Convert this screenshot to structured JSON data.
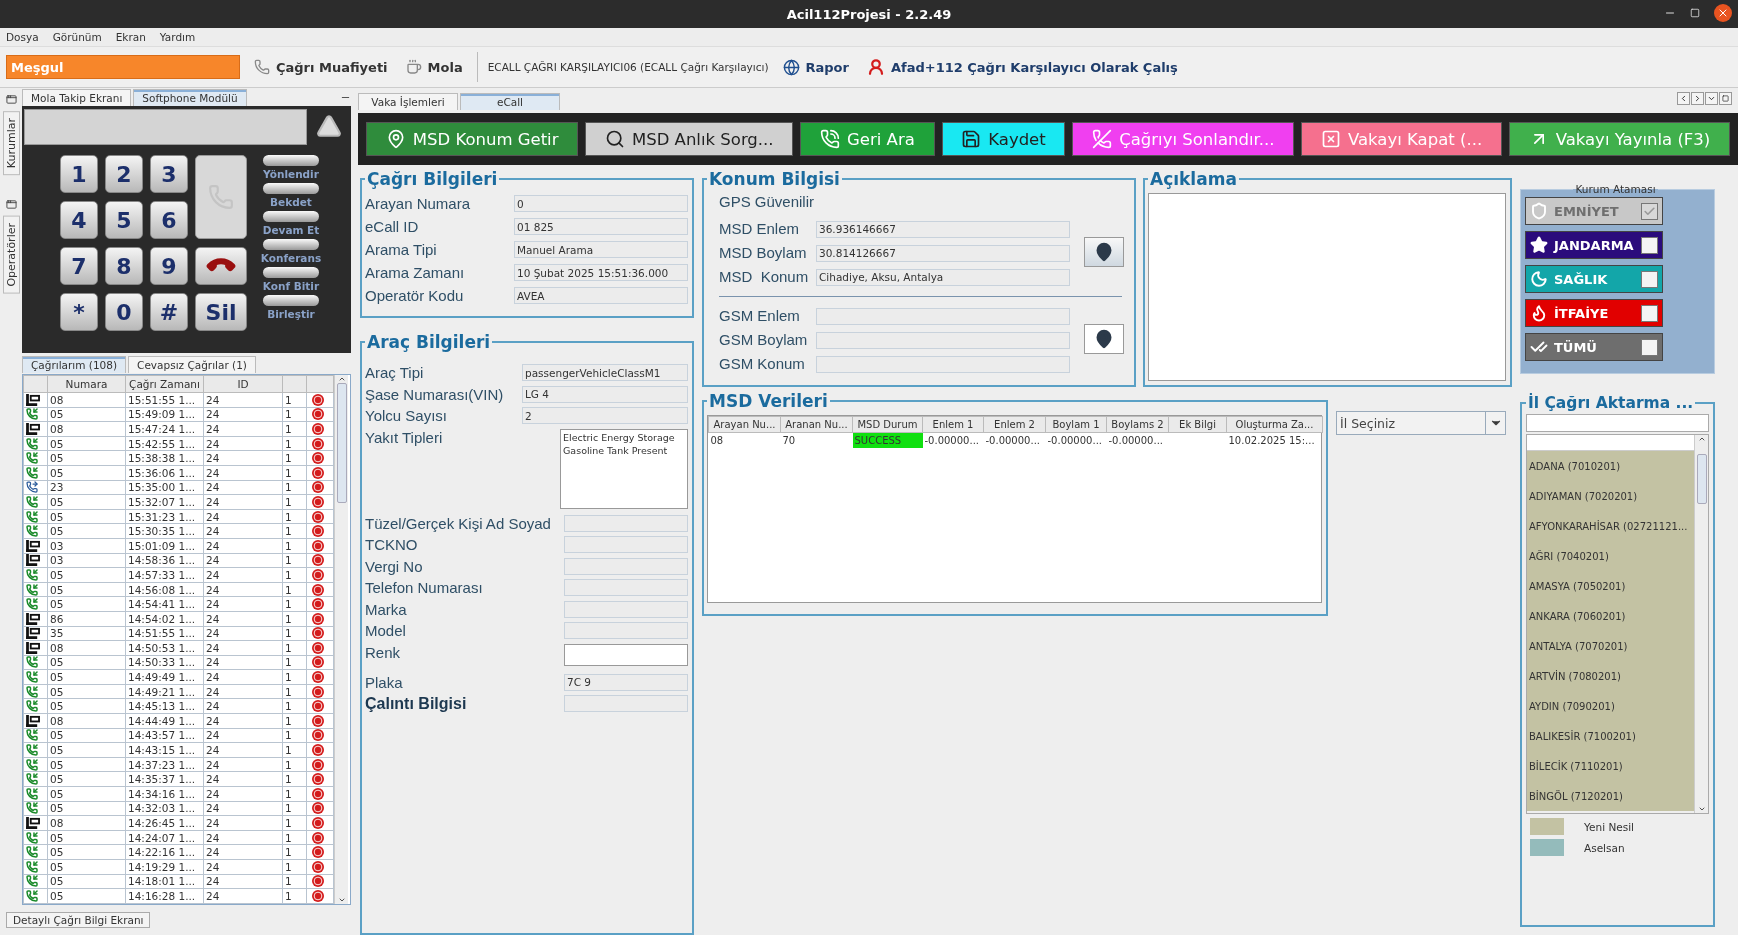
{
  "window": {
    "title": "Acil112Projesi - 2.2.49"
  },
  "menu": [
    "Dosya",
    "Görünüm",
    "Ekran",
    "Yardım"
  ],
  "toolbar": {
    "status": "Meşgul",
    "items": [
      {
        "kind": "phone",
        "label": "Çağrı Muafiyeti"
      },
      {
        "kind": "cup",
        "label": "Mola"
      }
    ],
    "role": "ECALL ÇAĞRI KARŞILAYICI06 (ECALL Çağrı Karşılayıcı)",
    "links": [
      {
        "kind": "globe",
        "label": "Rapor"
      },
      {
        "kind": "person",
        "label": "Afad+112 Çağrı Karşılayıcı Olarak Çalış"
      }
    ]
  },
  "side_tabs": [
    "Kurumlar",
    "Operatörler"
  ],
  "left_tabs": [
    {
      "label": "Mola Takip Ekranı",
      "selected": false
    },
    {
      "label": "Softphone Modülü",
      "selected": true
    }
  ],
  "softphone": {
    "keys": [
      "1",
      "2",
      "3",
      "4",
      "5",
      "6",
      "7",
      "8",
      "9",
      "*",
      "0",
      "#"
    ],
    "delete_key": "Sil",
    "actions": [
      "Yönlendir",
      "Bekdet",
      "Devam Et",
      "Konferans",
      "Konf Bitir",
      "Birleştir"
    ]
  },
  "call_tabs": [
    {
      "label": "Çağrılarım (108)",
      "selected": true
    },
    {
      "label": "Cevapsız Çağrılar (1)",
      "selected": false
    }
  ],
  "call_table": {
    "columns": [
      "Numara",
      "Çağrı Zamanı",
      "ID"
    ],
    "rows": [
      {
        "kind": "ecall",
        "number": "08",
        "time": "15:51:55 1...",
        "id": "24",
        "count": "1"
      },
      {
        "kind": "incoming",
        "number": "05",
        "time": "15:49:09 1...",
        "id": "24",
        "count": "1"
      },
      {
        "kind": "ecall",
        "number": "08",
        "time": "15:47:24 1...",
        "id": "24",
        "count": "1"
      },
      {
        "kind": "incoming",
        "number": "05",
        "time": "15:42:55 1...",
        "id": "24",
        "count": "1"
      },
      {
        "kind": "incoming",
        "number": "05",
        "time": "15:38:38 1...",
        "id": "24",
        "count": "1"
      },
      {
        "kind": "incoming",
        "number": "05",
        "time": "15:36:06 1...",
        "id": "24",
        "count": "1"
      },
      {
        "kind": "transfer",
        "number": "23",
        "time": "15:35:00 1...",
        "id": "24",
        "count": "1"
      },
      {
        "kind": "incoming",
        "number": "05",
        "time": "15:32:07 1...",
        "id": "24",
        "count": "1"
      },
      {
        "kind": "incoming",
        "number": "05",
        "time": "15:31:23 1...",
        "id": "24",
        "count": "1"
      },
      {
        "kind": "incoming",
        "number": "05",
        "time": "15:30:35 1...",
        "id": "24",
        "count": "1"
      },
      {
        "kind": "ecall",
        "number": "03",
        "time": "15:01:09 1...",
        "id": "24",
        "count": "1"
      },
      {
        "kind": "ecall",
        "number": "03",
        "time": "14:58:36 1...",
        "id": "24",
        "count": "1"
      },
      {
        "kind": "incoming",
        "number": "05",
        "time": "14:57:33 1...",
        "id": "24",
        "count": "1"
      },
      {
        "kind": "incoming",
        "number": "05",
        "time": "14:56:08 1...",
        "id": "24",
        "count": "1"
      },
      {
        "kind": "incoming",
        "number": "05",
        "time": "14:54:41 1...",
        "id": "24",
        "count": "1"
      },
      {
        "kind": "ecall",
        "number": "86",
        "time": "14:54:02 1...",
        "id": "24",
        "count": "1"
      },
      {
        "kind": "ecall",
        "number": "35",
        "time": "14:51:55 1...",
        "id": "24",
        "count": "1"
      },
      {
        "kind": "ecall",
        "number": "08",
        "time": "14:50:53 1...",
        "id": "24",
        "count": "1"
      },
      {
        "kind": "incoming",
        "number": "05",
        "time": "14:50:33 1...",
        "id": "24",
        "count": "1"
      },
      {
        "kind": "incoming",
        "number": "05",
        "time": "14:49:49 1...",
        "id": "24",
        "count": "1"
      },
      {
        "kind": "incoming",
        "number": "05",
        "time": "14:49:21 1...",
        "id": "24",
        "count": "1"
      },
      {
        "kind": "incoming",
        "number": "05",
        "time": "14:45:13 1...",
        "id": "24",
        "count": "1"
      },
      {
        "kind": "ecall",
        "number": "08",
        "time": "14:44:49 1...",
        "id": "24",
        "count": "1"
      },
      {
        "kind": "incoming",
        "number": "05",
        "time": "14:43:57 1...",
        "id": "24",
        "count": "1"
      },
      {
        "kind": "incoming",
        "number": "05",
        "time": "14:43:15 1...",
        "id": "24",
        "count": "1"
      },
      {
        "kind": "incoming",
        "number": "05",
        "time": "14:37:23 1...",
        "id": "24",
        "count": "1"
      },
      {
        "kind": "incoming",
        "number": "05",
        "time": "14:35:37 1...",
        "id": "24",
        "count": "1"
      },
      {
        "kind": "incoming",
        "number": "05",
        "time": "14:34:16 1...",
        "id": "24",
        "count": "1"
      },
      {
        "kind": "incoming",
        "number": "05",
        "time": "14:32:03 1...",
        "id": "24",
        "count": "1"
      },
      {
        "kind": "ecall",
        "number": "08",
        "time": "14:26:45 1...",
        "id": "24",
        "count": "1"
      },
      {
        "kind": "incoming",
        "number": "05",
        "time": "14:24:07 1...",
        "id": "24",
        "count": "1"
      },
      {
        "kind": "incoming",
        "number": "05",
        "time": "14:22:16 1...",
        "id": "24",
        "count": "1"
      },
      {
        "kind": "incoming",
        "number": "05",
        "time": "14:19:29 1...",
        "id": "24",
        "count": "1"
      },
      {
        "kind": "incoming",
        "number": "05",
        "time": "14:18:01 1...",
        "id": "24",
        "count": "1"
      },
      {
        "kind": "incoming",
        "number": "05",
        "time": "14:16:28 1...",
        "id": "24",
        "count": "1"
      }
    ]
  },
  "detail_button": "Detaylı Çağrı Bilgi Ekranı",
  "main_tabs": [
    {
      "label": "Vaka İşlemleri",
      "selected": false
    },
    {
      "label": "eCall",
      "selected": true
    }
  ],
  "actions": [
    {
      "kind": "pin",
      "label": "MSD Konum Getir",
      "color": "#2f8c3c"
    },
    {
      "kind": "search",
      "label": "MSD Anlık Sorg...",
      "color": "#d0d0d0"
    },
    {
      "kind": "callback",
      "label": "Geri Ara",
      "color": "#1fa23a"
    },
    {
      "kind": "save",
      "label": "Kaydet",
      "color": "#19e8f2"
    },
    {
      "kind": "hangup",
      "label": "Çağrıyı Sonlandır...",
      "color": "#f03ff0"
    },
    {
      "kind": "close",
      "label": "Vakayı Kapat (...",
      "color": "#f5708e"
    },
    {
      "kind": "publish",
      "label": "Vakayı Yayınla (F3)",
      "color": "#40b04c"
    }
  ],
  "call_info": {
    "title": "Çağrı Bilgileri",
    "fields": [
      {
        "label": "Arayan Numara",
        "value": "0"
      },
      {
        "label": "eCall ID",
        "value": "01 825"
      },
      {
        "label": "Arama Tipi",
        "value": "Manuel Arama"
      },
      {
        "label": "Arama Zamanı",
        "value": "10 Şubat 2025 15:51:36.000"
      },
      {
        "label": "Operatör Kodu",
        "value": "AVEA"
      }
    ]
  },
  "vehicle_info": {
    "title": "Araç Bilgileri",
    "fields": [
      {
        "kind": "wide",
        "label": "Araç Tipi",
        "value": "passengerVehicleClassM1"
      },
      {
        "kind": "wide",
        "label": "Şase Numarası(VIN)",
        "value": "LG 4"
      },
      {
        "kind": "wide",
        "label": "Yolcu Sayısı",
        "value": "2"
      },
      {
        "kind": "list",
        "label": "Yakıt Tipleri",
        "lines": [
          "Electric Energy Storage",
          "Gasoline Tank Present"
        ]
      },
      {
        "kind": "narrow",
        "label": "Tüzel/Gerçek Kişi Ad Soyad"
      },
      {
        "kind": "narrow",
        "label": "TCKNO"
      },
      {
        "kind": "narrow",
        "label": "Vergi No"
      },
      {
        "kind": "narrow",
        "label": "Telefon Numarası"
      },
      {
        "kind": "narrow",
        "label": "Marka"
      },
      {
        "kind": "narrow",
        "label": "Model"
      },
      {
        "kind": "editable",
        "label": "Renk"
      },
      {
        "kind": "narrow",
        "label": "Plaka",
        "value": "7C 9"
      },
      {
        "kind": "heading",
        "label": "Çalıntı Bilgisi"
      }
    ]
  },
  "location": {
    "title": "Konum Bilgisi",
    "gps_status": "GPS Güvenilir",
    "msd_fields": [
      {
        "label": "MSD Enlem",
        "value": "36.936146667"
      },
      {
        "label": "MSD Boylam",
        "value": "30.814126667"
      },
      {
        "label": "MSD  Konum",
        "value": "Cihadiye, Aksu, Antalya"
      }
    ],
    "gsm_fields": [
      {
        "label": "GSM Enlem"
      },
      {
        "label": "GSM Boylam"
      },
      {
        "label": "GSM Konum"
      }
    ]
  },
  "description": {
    "title": "Açıklama"
  },
  "msd_data": {
    "title": "MSD Verileri",
    "columns": [
      "Arayan Nu...",
      "Aranan Nu...",
      "MSD Durum",
      "Enlem 1",
      "Enlem 2",
      "Boylam 1",
      "Boylams 2",
      "Ek Bilgi",
      "Oluşturma Za..."
    ],
    "rows": [
      {
        "cells": [
          {
            "text": "08",
            "highlight": false
          },
          {
            "text": "70",
            "highlight": false
          },
          {
            "text": "SUCCESS",
            "highlight": true
          },
          {
            "text": "-0.00000...",
            "highlight": false
          },
          {
            "text": "-0.00000...",
            "highlight": false
          },
          {
            "text": "-0.00000...",
            "highlight": false
          },
          {
            "text": "-0.00000...",
            "highlight": false
          },
          {
            "text": "",
            "highlight": false
          },
          {
            "text": "10.02.2025 15:...",
            "highlight": false
          }
        ]
      }
    ]
  },
  "province_select": {
    "value": "İl Seçiniz"
  },
  "agencies": {
    "title": "Kurum Ataması",
    "items": [
      {
        "kind": "shield",
        "label": "EMNİYET",
        "color": "#c8c8c8",
        "disabled": true,
        "checked": true
      },
      {
        "kind": "star",
        "label": "JANDARMA",
        "color": "#2b0b7c",
        "disabled": false,
        "checked": false
      },
      {
        "kind": "crescent",
        "label": "SAĞLIK",
        "color": "#13a6a9",
        "disabled": false,
        "checked": false
      },
      {
        "kind": "flame",
        "label": "İTFAİYE",
        "color": "#e10000",
        "disabled": false,
        "checked": false
      },
      {
        "kind": "all",
        "label": "TÜMÜ",
        "color": "#6e6e6e",
        "disabled": false,
        "checked": false
      }
    ]
  },
  "transfer": {
    "title": "İl Çağrı Aktarma ...",
    "provinces": [
      {
        "label": "ADANA  (7010201)",
        "color": "#c3c2a3"
      },
      {
        "label": "ADIYAMAN  (7020201)",
        "color": "#c3c2a3"
      },
      {
        "label": "AFYONKARAHİSAR  (02721121...",
        "color": "#c3c2a3"
      },
      {
        "label": "AĞRI  (7040201)",
        "color": "#c3c2a3"
      },
      {
        "label": "AMASYA  (7050201)",
        "color": "#c3c2a3"
      },
      {
        "label": "ANKARA  (7060201)",
        "color": "#c3c2a3"
      },
      {
        "label": "ANTALYA  (7070201)",
        "color": "#c3c2a3"
      },
      {
        "label": "ARTVİN  (7080201)",
        "color": "#c3c2a3"
      },
      {
        "label": "AYDIN  (7090201)",
        "color": "#c3c2a3"
      },
      {
        "label": "BALIKESİR  (7100201)",
        "color": "#c3c2a3"
      },
      {
        "label": "BİLECİK  (7110201)",
        "color": "#c3c2a3"
      },
      {
        "label": "BİNGÖL  (7120201)",
        "color": "#c3c2a3"
      }
    ],
    "legend": [
      {
        "label": "Yeni Nesil",
        "color": "#c3c2a3"
      },
      {
        "label": "Aselsan",
        "color": "#94bbbb"
      }
    ]
  }
}
